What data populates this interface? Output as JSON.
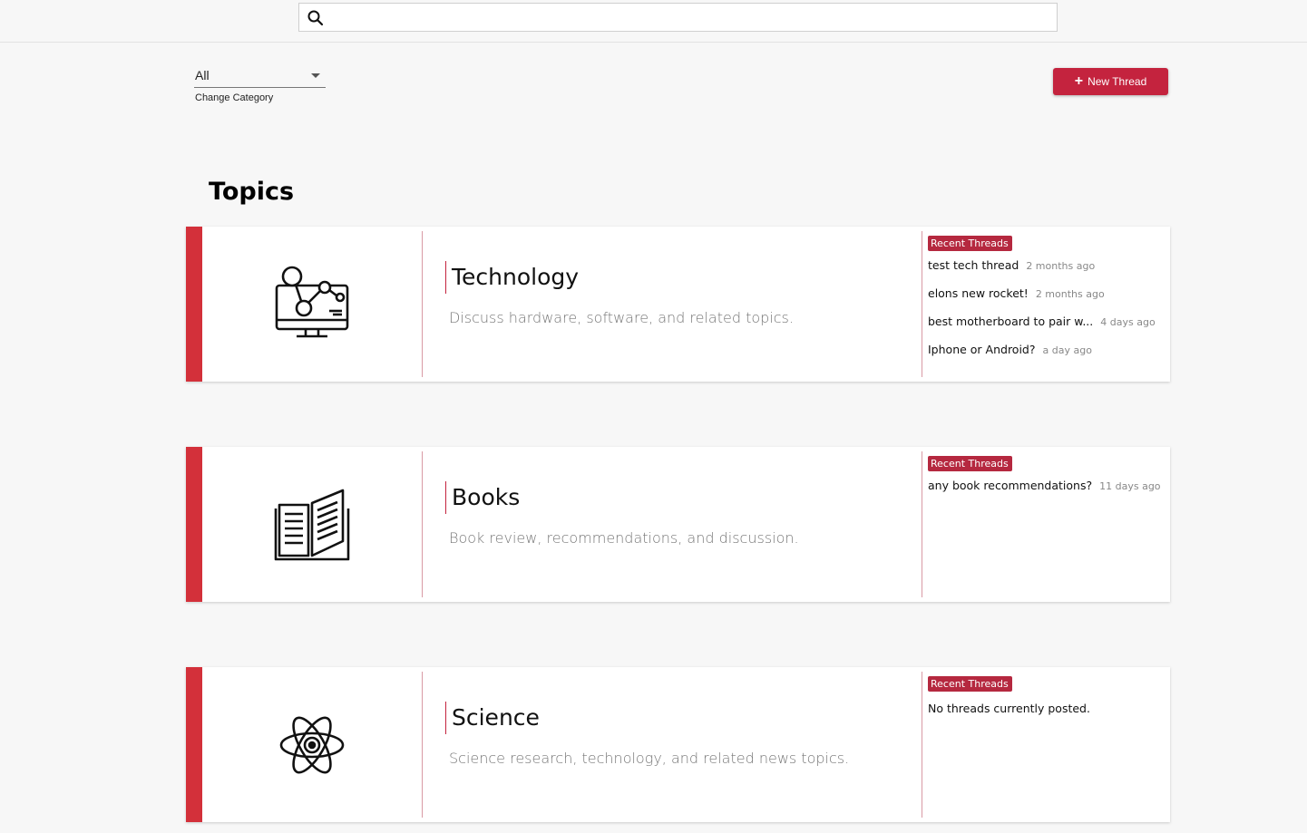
{
  "search": {
    "value": "",
    "placeholder": ""
  },
  "category": {
    "selected": "All",
    "helper": "Change Category"
  },
  "toolbar": {
    "new_thread_label": "New Thread"
  },
  "section_title": "Topics",
  "recent_label": "Recent Threads",
  "colors": {
    "accent": "#d3303a",
    "button": "#c4233e",
    "badge": "#b5283f"
  },
  "topics": [
    {
      "name": "Technology",
      "icon": "computer-network-icon",
      "description": "Discuss hardware, software, and related topics.",
      "recent_threads": [
        {
          "title": "test tech thread",
          "time": "2 months ago"
        },
        {
          "title": "elons new rocket!",
          "time": "2 months ago"
        },
        {
          "title": "best motherboard to pair w...",
          "time": "4 days ago"
        },
        {
          "title": "Iphone or Android?",
          "time": "a day ago"
        }
      ]
    },
    {
      "name": "Books",
      "icon": "open-book-icon",
      "description": "Book review, recommendations, and discussion.",
      "recent_threads": [
        {
          "title": "any book recommendations?",
          "time": "11 days ago"
        }
      ]
    },
    {
      "name": "Science",
      "icon": "atom-icon",
      "description": "Science research, technology, and related news topics.",
      "recent_threads": [],
      "empty_text": "No threads currently posted."
    }
  ]
}
